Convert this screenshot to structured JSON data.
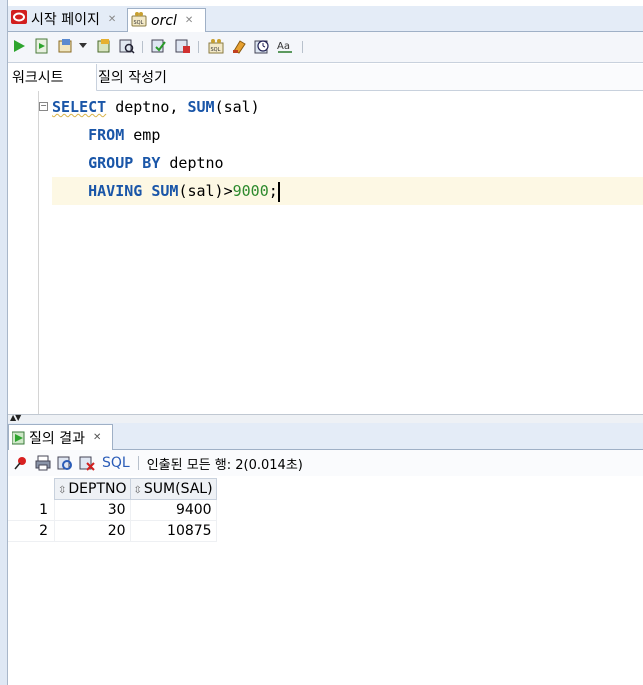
{
  "doc_tabs": [
    {
      "label": "시작 페이지",
      "icon": "oracle-start-icon"
    },
    {
      "label": "orcl",
      "icon": "sql-connection-icon"
    }
  ],
  "toolbar": {
    "icons": [
      "run-statement-icon",
      "run-script-icon",
      "autotrace-icon",
      "dropdown-arrow-icon",
      "explain-plan-icon",
      "sql-tuning-icon",
      "commit-icon",
      "rollback-icon",
      "unshared-sql-icon",
      "clear-icon",
      "history-icon",
      "format-icon"
    ]
  },
  "sub_tabs": {
    "worksheet": "워크시트",
    "query_builder": "질의 작성기"
  },
  "editor": {
    "lines": [
      {
        "t": [
          {
            "k": "kw",
            "v": "SELECT"
          },
          {
            "k": "plain",
            "v": " deptno, "
          },
          {
            "k": "kw",
            "v": "SUM"
          },
          {
            "k": "plain",
            "v": "(sal)"
          }
        ]
      },
      {
        "t": [
          {
            "k": "plain",
            "v": "    "
          },
          {
            "k": "kw",
            "v": "FROM"
          },
          {
            "k": "plain",
            "v": " emp"
          }
        ]
      },
      {
        "t": [
          {
            "k": "plain",
            "v": "    "
          },
          {
            "k": "kw",
            "v": "GROUP BY"
          },
          {
            "k": "plain",
            "v": " deptno"
          }
        ]
      },
      {
        "t": [
          {
            "k": "plain",
            "v": "    "
          },
          {
            "k": "kw",
            "v": "HAVING"
          },
          {
            "k": "plain",
            "v": " "
          },
          {
            "k": "kw",
            "v": "SUM"
          },
          {
            "k": "plain",
            "v": "(sal)>"
          },
          {
            "k": "num",
            "v": "9000"
          },
          {
            "k": "plain",
            "v": ";"
          }
        ],
        "current": true
      }
    ]
  },
  "results": {
    "tab_label": "질의 결과",
    "sql_label": "SQL",
    "status": "인출된 모든 행: 2(0.014초)",
    "columns": [
      "DEPTNO",
      "SUM(SAL)"
    ],
    "rows": [
      {
        "n": "1",
        "cells": [
          "30",
          "9400"
        ]
      },
      {
        "n": "2",
        "cells": [
          "20",
          "10875"
        ]
      }
    ]
  },
  "colors": {
    "keyword": "#1a56a8",
    "number": "#2d8a2d",
    "current_line": "#fdf8e4",
    "tab_bar": "#e4ecf7"
  }
}
